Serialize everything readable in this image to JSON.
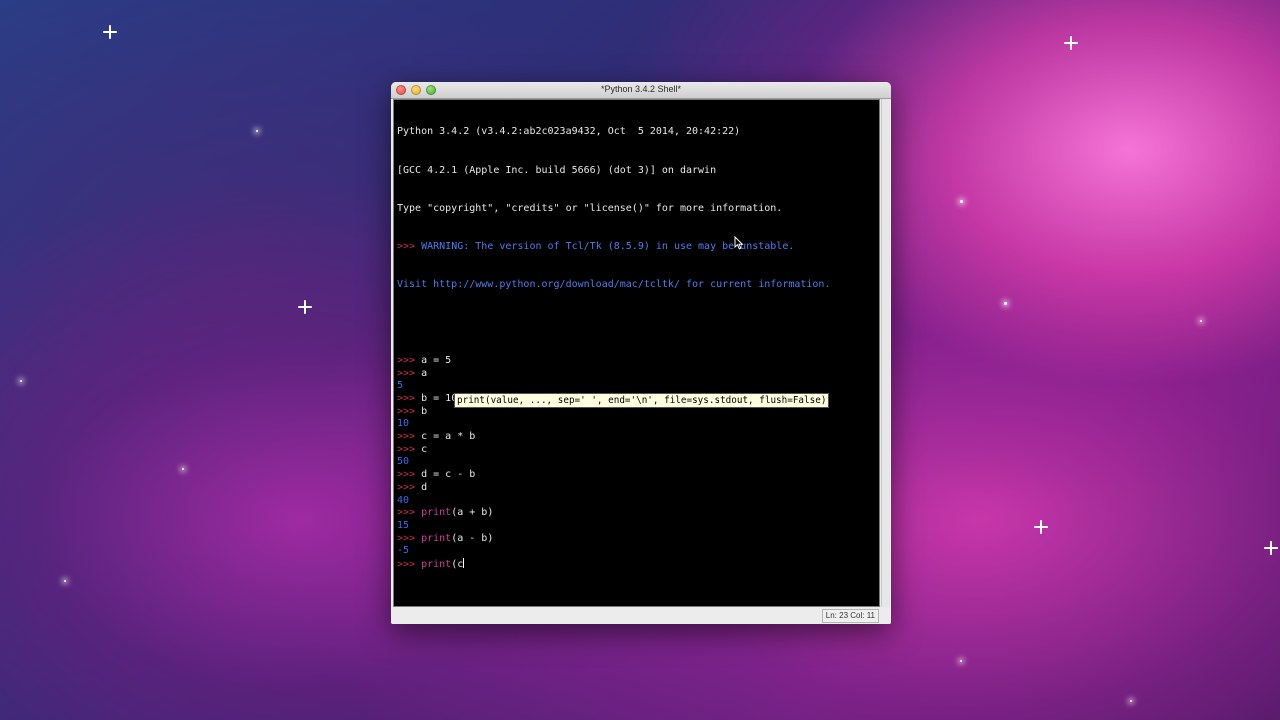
{
  "window": {
    "title": "*Python 3.4.2 Shell*"
  },
  "console": {
    "banner": [
      "Python 3.4.2 (v3.4.2:ab2c023a9432, Oct  5 2014, 20:42:22)",
      "[GCC 4.2.1 (Apple Inc. build 5666) (dot 3)] on darwin",
      "Type \"copyright\", \"credits\" or \"license()\" for more information."
    ],
    "warning": [
      ">>> WARNING: The version of Tcl/Tk (8.5.9) in use may be unstable.",
      "Visit http://www.python.org/download/mac/tcltk/ for current information."
    ],
    "prompt": ">>> ",
    "session": [
      {
        "kind": "input",
        "text": "a = 5"
      },
      {
        "kind": "input",
        "text": "a"
      },
      {
        "kind": "output",
        "text": "5"
      },
      {
        "kind": "input",
        "text": "b = 10"
      },
      {
        "kind": "input",
        "text": "b"
      },
      {
        "kind": "output",
        "text": "10"
      },
      {
        "kind": "input",
        "text": "c = a * b"
      },
      {
        "kind": "input",
        "text": "c"
      },
      {
        "kind": "output",
        "text": "50"
      },
      {
        "kind": "input",
        "text": "d = c - b"
      },
      {
        "kind": "input",
        "text": "d"
      },
      {
        "kind": "output",
        "text": "40"
      },
      {
        "kind": "input",
        "keyword": "print",
        "text": "(a + b)"
      },
      {
        "kind": "output",
        "text": "15"
      },
      {
        "kind": "input",
        "keyword": "print",
        "text": "(a - b)"
      },
      {
        "kind": "output",
        "text": "-5"
      },
      {
        "kind": "input",
        "keyword": "print",
        "text": "(c",
        "cursor": true
      }
    ],
    "calltip": "print(value, ..., sep=' ', end='\\n', file=sys.stdout, flush=False)"
  },
  "statusbar": {
    "position": "Ln: 23 Col: 11"
  },
  "colors": {
    "prompt": "#c8324c",
    "keyword": "#d23b9e",
    "output": "#3a6cf0",
    "calltip_bg": "#ffffe0"
  }
}
